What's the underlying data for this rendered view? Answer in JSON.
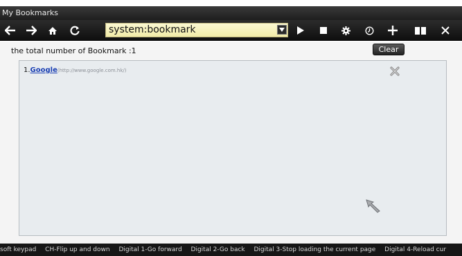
{
  "window": {
    "title": "My Bookmarks"
  },
  "toolbar": {
    "url_value": "system:bookmark",
    "buttons": [
      "back-arrow-icon",
      "forward-arrow-icon",
      "home-icon",
      "refresh-icon",
      "dropdown-icon",
      "play-icon",
      "stop-icon",
      "settings-gear-icon",
      "clock-icon",
      "add-plus-icon",
      "bookmarks-book-icon",
      "close-x-icon"
    ]
  },
  "content": {
    "total_label": "the total number of Bookmark :1",
    "clear_label": "Clear",
    "bookmarks": [
      {
        "index": "1.",
        "title": "Google",
        "url": "(http://www.google.com.hk/)"
      }
    ]
  },
  "hints": [
    "soft keypad",
    "CH-Flip up and down",
    "Digital 1-Go forward",
    "Digital 2-Go back",
    "Digital 3-Stop loading the current page",
    "Digital 4-Reload cur"
  ],
  "colors": {
    "titlebar": "#2a2a2a",
    "toolbar": "#1a1a1a",
    "url_bg": "#f6f1bd",
    "link": "#1a3fb3",
    "panel_bg": "#e8ecef"
  }
}
